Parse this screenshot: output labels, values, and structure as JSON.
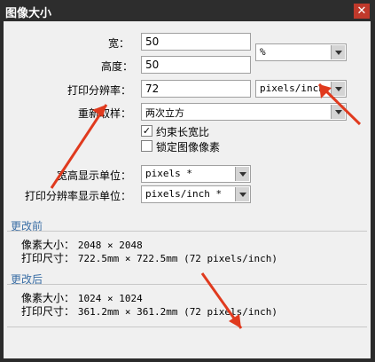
{
  "window": {
    "title": "图像大小",
    "close_glyph": "✕"
  },
  "fields": {
    "width": {
      "label": "宽",
      "value": "50"
    },
    "height": {
      "label": "高度",
      "value": "50"
    },
    "unit": "%",
    "resolution": {
      "label": "打印分辨率",
      "value": "72",
      "unit": "pixels/inch"
    },
    "resample": {
      "label": "重新取样",
      "value": "两次立方"
    }
  },
  "checkboxes": {
    "constrain": {
      "label": "约束长宽比",
      "checked_glyph": "✓"
    },
    "lock": {
      "label": "锁定图像像素",
      "checked_glyph": ""
    }
  },
  "display": {
    "wh_unit": {
      "label": "宽高显示单位",
      "value": "pixels *"
    },
    "res_unit": {
      "label": "打印分辨率显示单位",
      "value": "pixels/inch *"
    }
  },
  "colon": "：",
  "before": {
    "heading": "更改前",
    "pixel_label": "像素大小",
    "pixel_value": "2048 × 2048",
    "print_label": "打印尺寸",
    "print_value": "722.5mm × 722.5mm (72 pixels/inch)"
  },
  "after": {
    "heading": "更改后",
    "pixel_label": "像素大小",
    "pixel_value": "1024 × 1024",
    "print_label": "打印尺寸",
    "print_value": "361.2mm × 361.2mm (72 pixels/inch)"
  },
  "colors": {
    "title_bg": "#2d2d2d",
    "close_bg": "#c0392b",
    "panel_bg": "#f0f0f0",
    "section_text": "#3a6ea5",
    "arrow": "#e03a1e"
  }
}
